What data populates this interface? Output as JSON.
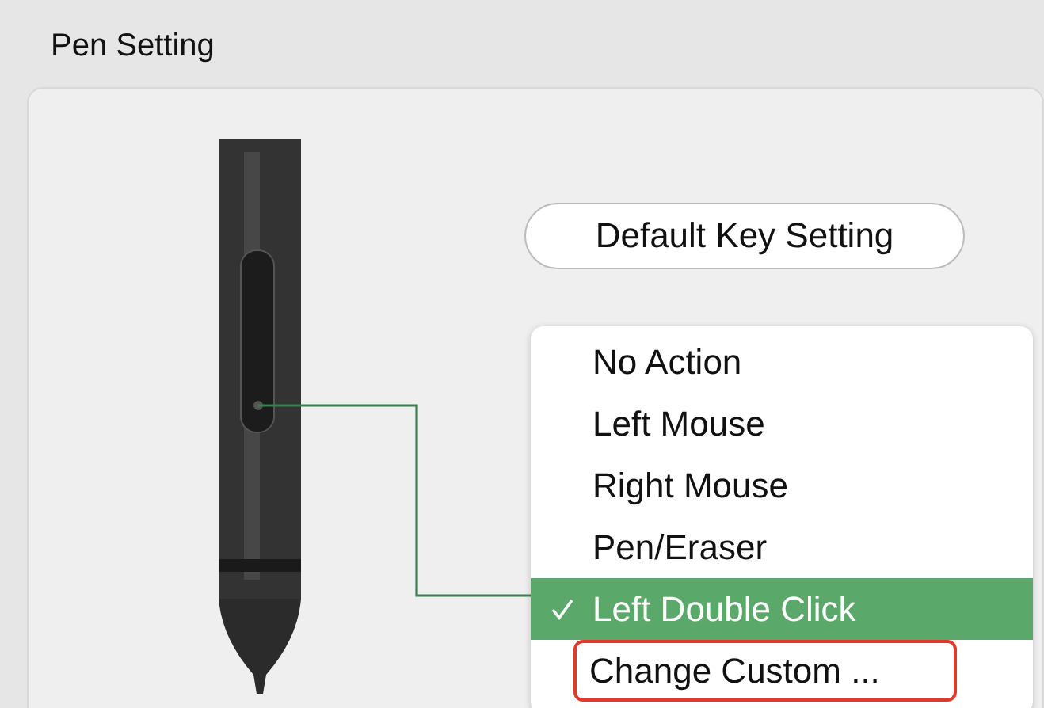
{
  "title": "Pen Setting",
  "default_button": {
    "label": "Default Key Setting"
  },
  "menu": {
    "items": [
      {
        "label": "No Action",
        "selected": false,
        "highlighted": false
      },
      {
        "label": "Left Mouse",
        "selected": false,
        "highlighted": false
      },
      {
        "label": "Right Mouse",
        "selected": false,
        "highlighted": false
      },
      {
        "label": "Pen/Eraser",
        "selected": false,
        "highlighted": false
      },
      {
        "label": "Left Double Click",
        "selected": true,
        "highlighted": false
      },
      {
        "label": "Change Custom ...",
        "selected": false,
        "highlighted": true
      }
    ]
  }
}
